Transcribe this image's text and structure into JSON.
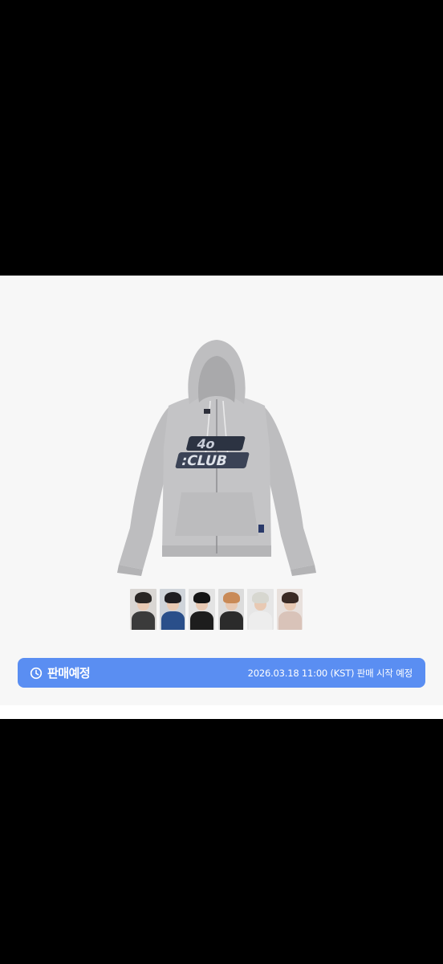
{
  "sale": {
    "status": "판매예정",
    "date_text": "2026.03.18 11:00 (KST) 판매 시작 예정"
  },
  "hoodie": {
    "graphic_line1": "4o",
    "graphic_line2": ":CLUB"
  },
  "photocards": [
    {
      "name": "card-1",
      "bg": "#d9d6d3",
      "hair": "#2a2624",
      "body": "#3b3b3b"
    },
    {
      "name": "card-2",
      "bg": "#cfd4da",
      "hair": "#1f1e22",
      "body": "#2a4f8a"
    },
    {
      "name": "card-3",
      "bg": "#e3e3e3",
      "hair": "#151515",
      "body": "#1d1d1d"
    },
    {
      "name": "card-4",
      "bg": "#dcdcdc",
      "hair": "#c98a57",
      "body": "#2b2b2b"
    },
    {
      "name": "card-5",
      "bg": "#e6e6e6",
      "hair": "#d7d7d0",
      "body": "#ededed"
    },
    {
      "name": "card-6",
      "bg": "#e8e0dc",
      "hair": "#3a2a24",
      "body": "#d9c3b9"
    }
  ],
  "colors": {
    "accent": "#5a8ef2",
    "panel_background": "#f7f7f7",
    "hoodie": "#c2c2c4"
  }
}
